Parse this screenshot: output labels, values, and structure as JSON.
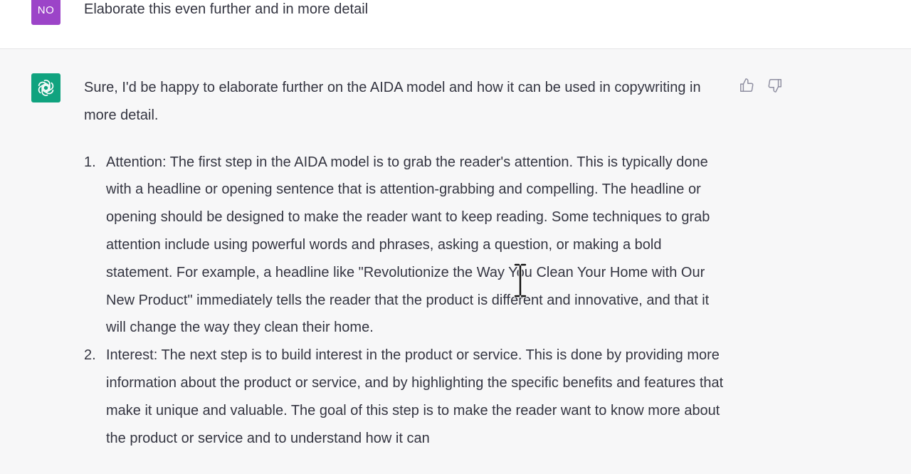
{
  "user": {
    "avatar_initials": "NO",
    "avatar_color": "#9c44c8",
    "message": "Elaborate this even further and in more detail"
  },
  "assistant": {
    "avatar_icon": "chatgpt-logo-icon",
    "avatar_color": "#10a37f",
    "intro": "Sure, I'd be happy to elaborate further on the AIDA model and how it can be used in copywriting in more detail.",
    "points": [
      {
        "number": "1.",
        "text": "Attention: The first step in the AIDA model is to grab the reader's attention. This is typically done with a headline or opening sentence that is attention-grabbing and compelling. The headline or opening should be designed to make the reader want to keep reading. Some techniques to grab attention include using powerful words and phrases, asking a question, or making a bold statement. For example, a headline like \"Revolutionize the Way You Clean Your Home with Our New Product\" immediately tells the reader that the product is different and innovative, and that it will change the way they clean their home."
      },
      {
        "number": "2.",
        "text": "Interest: The next step is to build interest in the product or service. This is done by providing more information about the product or service, and by highlighting the specific benefits and features that make it unique and valuable. The goal of this step is to make the reader want to know more about the product or service and to understand how it can"
      }
    ],
    "feedback": {
      "thumbs_up_icon": "thumbs-up-icon",
      "thumbs_down_icon": "thumbs-down-icon"
    }
  }
}
